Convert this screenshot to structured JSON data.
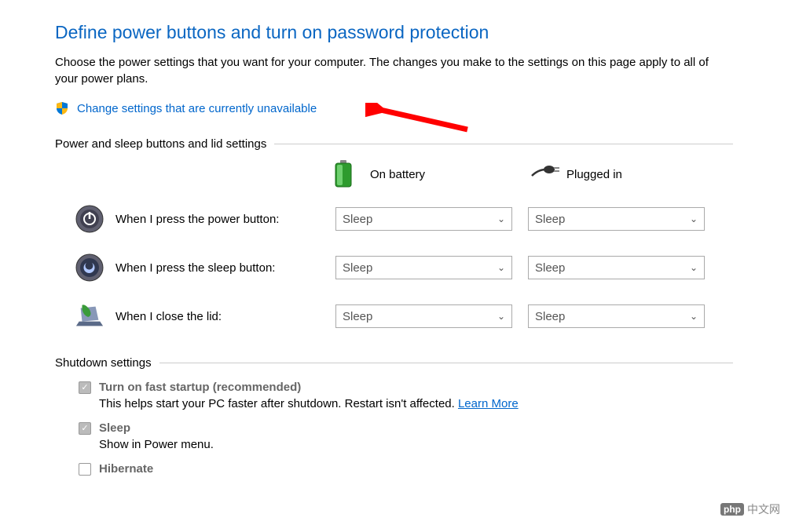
{
  "heading": "Define power buttons and turn on password protection",
  "description": "Choose the power settings that you want for your computer. The changes you make to the settings on this page apply to all of your power plans.",
  "change_link": "Change settings that are currently unavailable",
  "section1": {
    "title": "Power and sleep buttons and lid settings",
    "col_battery": "On battery",
    "col_plugged": "Plugged in",
    "rows": [
      {
        "label": "When I press the power button:",
        "battery": "Sleep",
        "plugged": "Sleep"
      },
      {
        "label": "When I press the sleep button:",
        "battery": "Sleep",
        "plugged": "Sleep"
      },
      {
        "label": "When I close the lid:",
        "battery": "Sleep",
        "plugged": "Sleep"
      }
    ]
  },
  "section2": {
    "title": "Shutdown settings",
    "items": [
      {
        "title": "Turn on fast startup (recommended)",
        "desc_prefix": "This helps start your PC faster after shutdown. Restart isn't affected. ",
        "learn_more": "Learn More",
        "checked": true
      },
      {
        "title": "Sleep",
        "desc": "Show in Power menu.",
        "checked": true
      },
      {
        "title": "Hibernate",
        "desc": "",
        "checked": false
      }
    ]
  },
  "watermark": "中文网"
}
